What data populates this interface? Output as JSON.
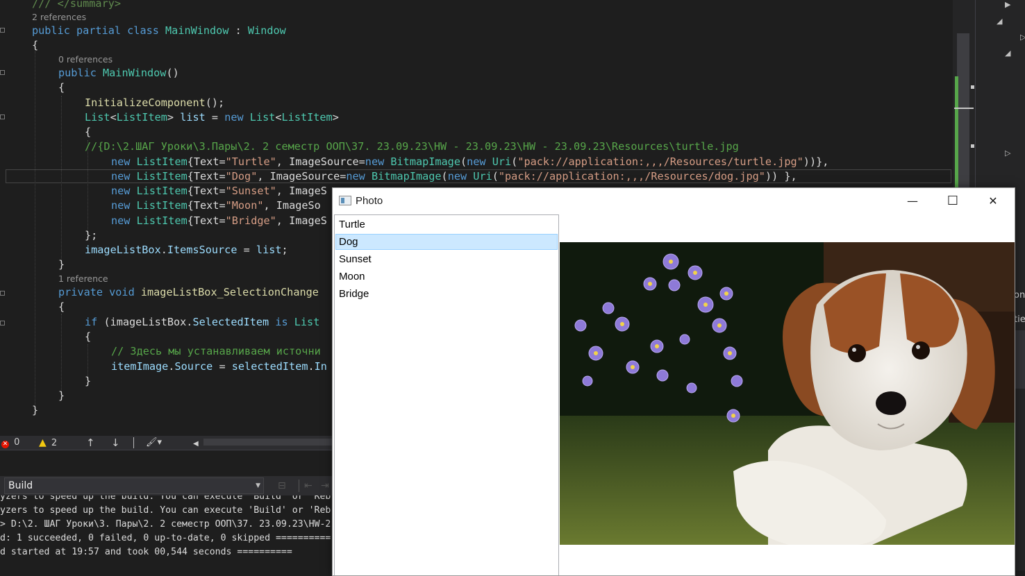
{
  "editor": {
    "codelens": {
      "class_refs": "2 references",
      "ctor_refs": "0 references",
      "method_refs": "1 reference"
    },
    "lines": {
      "summary": "/// </summary>",
      "class_kw": "public partial class ",
      "class_name": "MainWindow",
      "colon": " : ",
      "base_class": "Window",
      "brace_open": "{",
      "brace_close": "}",
      "ctor_kw": "public ",
      "ctor_name": "MainWindow",
      "parens": "()",
      "init_call": "InitializeComponent",
      "init_rest": "();",
      "list_type": "List",
      "lt": "<",
      "item_type": "ListItem",
      "gt": ">",
      "list_var": " list",
      "assign": " = ",
      "new_kw": "new",
      "path_comment": "//{D:\\2.ШАГ Уроки\\3.Пары\\2. 2 семестр ООП\\37. 23.09.23\\HW - 23.09.23\\HW - 23.09.23\\Resources\\turtle.jpg",
      "turtle_pre": "{Text=",
      "turtle_str": "\"Turtle\"",
      "turtle_mid": ", ImageSource=",
      "bitmap": "BitmapImage",
      "uri": "Uri",
      "turtle_uri": "\"pack://application:,,,/Resources/turtle.jpg\"",
      "turtle_end": "))},",
      "dog_pre": "{Text=",
      "dog_str": "\"Dog\"",
      "dog_mid": ", ImageSource=",
      "dog_uri": "\"pack://application:,,,/Resources/dog.jpg\"",
      "dog_end": ")) },",
      "sunset_str": "\"Sunset\"",
      "sunset_tail": ", ImageS",
      "moon_str": "\"Moon\"",
      "moon_tail": ", ImageSo",
      "bridge_str": "\"Bridge\"",
      "bridge_tail": ", ImageS",
      "list_close": "};",
      "items_source_obj": "imageListBox",
      "items_source_prop": "ItemsSource",
      "items_source_val": "list",
      "method_kw": "private void ",
      "method_name": "imageListBox_SelectionChange",
      "if_kw": "if",
      "if_rest": " (imageListBox.",
      "selected_item": "SelectedItem",
      "is_kw": " is ",
      "list_trunc": "List",
      "ru_comment": "// Здесь мы устанавливаем источни",
      "item_image": "itemImage",
      "source_prop": "Source",
      "selected_var": "selectedItem",
      "trunc_i": "In"
    }
  },
  "status": {
    "errors": "0",
    "warnings": "2",
    "error_color": "#e51400",
    "warning_color": "#f2c811"
  },
  "output": {
    "source_select": "Build",
    "lines": [
      "yzers to speed up the build. You can execute 'Build' or 'Reb",
      "yzers to speed up the build. You can execute 'Build' or 'Reb",
      "> D:\\2. ШАГ Уроки\\3. Пары\\2. 2 семестр ООП\\37. 23.09.23\\HW-2",
      "d: 1 succeeded, 0 failed, 0 up-to-date, 0 skipped ==========",
      "d started at 19:57 and took 00,544 seconds =========="
    ]
  },
  "right_panel": {
    "frag1": "on",
    "frag2": "tie"
  },
  "window": {
    "title": "Photo",
    "minimize_glyph": "—",
    "maximize_glyph": "☐",
    "close_glyph": "✕",
    "items": [
      "Turtle",
      "Dog",
      "Sunset",
      "Moon",
      "Bridge"
    ],
    "selected_index": 1,
    "image_subject": "puppy-photo"
  }
}
